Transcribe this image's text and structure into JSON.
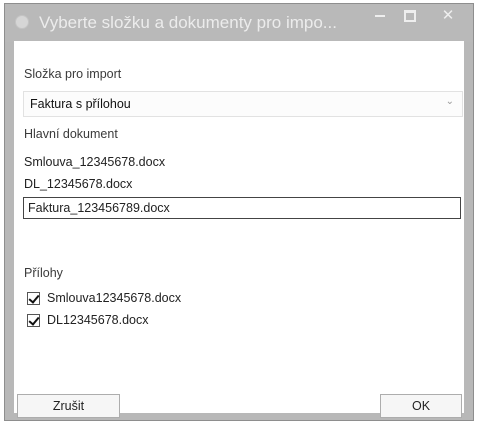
{
  "window": {
    "title": "Vyberte složku a dokumenty pro impo...",
    "controls": {
      "minimize": "minimize",
      "maximize": "maximize",
      "close": "close"
    }
  },
  "folder": {
    "label": "Složka pro import",
    "selected_value": "Faktura s přílohou"
  },
  "main_document": {
    "label": "Hlavní dokument",
    "items": [
      {
        "name": "Smlouva_12345678.docx",
        "selected": false
      },
      {
        "name": "DL_12345678.docx",
        "selected": false
      },
      {
        "name": "Faktura_123456789.docx",
        "selected": true
      }
    ]
  },
  "attachments": {
    "label": "Přílohy",
    "items": [
      {
        "name": "Smlouva12345678.docx",
        "checked": true
      },
      {
        "name": "DL12345678.docx",
        "checked": true
      }
    ]
  },
  "buttons": {
    "cancel": "Zrušit",
    "ok": "OK"
  },
  "colors": {
    "titlebar": "#b9b9b9",
    "content_background": "#ffffff"
  }
}
